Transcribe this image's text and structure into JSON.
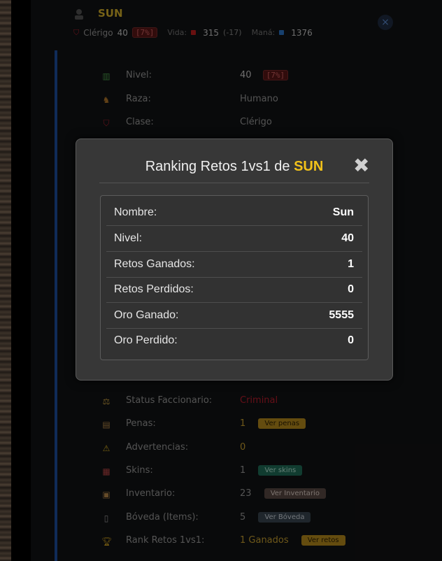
{
  "header": {
    "name": "SUN",
    "class": "Clérigo",
    "level": "40",
    "level_pct": "[7%]",
    "vida_label": "Vida:",
    "vida_value": "315",
    "vida_delta": "(-17)",
    "mana_label": "Maná:",
    "mana_value": "1376",
    "close_glyph": "×"
  },
  "rows": [
    {
      "label": "Nivel:",
      "value": "40",
      "badge": "[7%]",
      "icon": "chart-icon"
    },
    {
      "label": "Raza:",
      "value": "Humano",
      "icon": "horse-icon"
    },
    {
      "label": "Clase:",
      "value": "Clérigo",
      "icon": "shield-icon"
    },
    {
      "label": "Status Faccionario:",
      "value": "Criminal",
      "icon": "scales-icon"
    },
    {
      "label": "Penas:",
      "value": "1",
      "button": "Ver penas",
      "icon": "scroll-icon"
    },
    {
      "label": "Advertencias:",
      "value": "0",
      "icon": "warning-icon"
    },
    {
      "label": "Skins:",
      "value": "1",
      "button": "Ver skins",
      "icon": "shirt-icon"
    },
    {
      "label": "Inventario:",
      "value": "23",
      "button": "Ver Inventario",
      "icon": "bag-icon"
    },
    {
      "label": "Bóveda (Items):",
      "value": "5",
      "button": "Ver Bóveda",
      "icon": "vault-icon"
    },
    {
      "label": "Rank Retos 1vs1:",
      "value": "1 Ganados",
      "button": "Ver retos",
      "icon": "trophy-icon"
    }
  ],
  "modal": {
    "title_prefix": "Ranking Retos 1vs1 de",
    "title_name": "SUN",
    "close_glyph": "✖",
    "stats": [
      {
        "label": "Nombre:",
        "value": "Sun"
      },
      {
        "label": "Nivel:",
        "value": "40"
      },
      {
        "label": "Retos Ganados:",
        "value": "1"
      },
      {
        "label": "Retos Perdidos:",
        "value": "0"
      },
      {
        "label": "Oro Ganado:",
        "value": "5555"
      },
      {
        "label": "Oro Perdido:",
        "value": "0"
      }
    ]
  },
  "colors": {
    "accent": "#1e4fa0",
    "gold": "#f2c21a",
    "criminal": "#b81c2c"
  }
}
